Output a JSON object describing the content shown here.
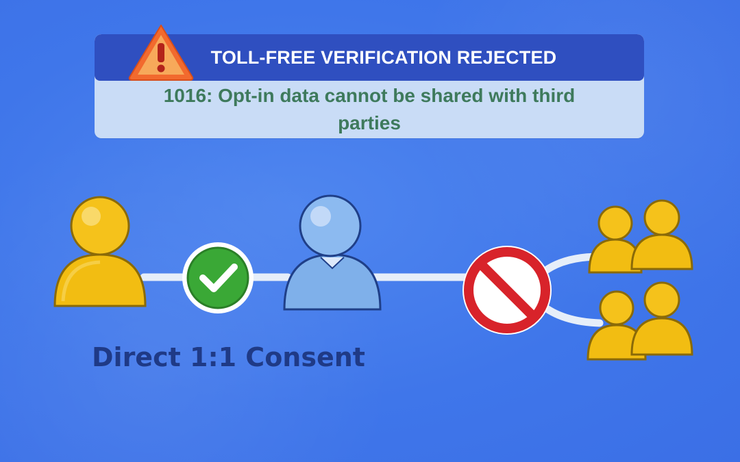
{
  "banner": {
    "title": "TOLL-FREE VERIFICATION REJECTED",
    "message": "1016: Opt-in data cannot be shared with third parties"
  },
  "diagram": {
    "caption": "Direct 1:1 Consent",
    "nodes": [
      {
        "role": "consumer",
        "icon": "person-icon",
        "color": "#f2bd12"
      },
      {
        "role": "approved",
        "icon": "check-icon",
        "color": "#3aa836"
      },
      {
        "role": "business",
        "icon": "person-icon",
        "color": "#7fb0ea"
      },
      {
        "role": "blocked",
        "icon": "prohibited-icon",
        "color": "#d8232a"
      },
      {
        "role": "third-parties",
        "icon": "group-icon",
        "color": "#f2bd12"
      }
    ]
  },
  "colors": {
    "background": "#3f76ea",
    "banner_header": "#2f4fc0",
    "banner_body": "#c9dcf6",
    "message_text": "#3e7a5c",
    "caption_text": "#1f3a86",
    "connector": "#e6eef9"
  }
}
